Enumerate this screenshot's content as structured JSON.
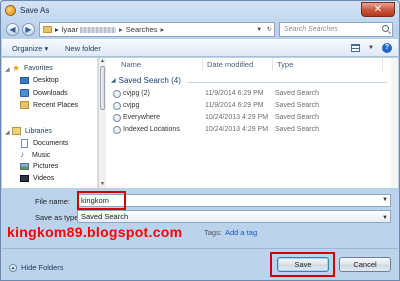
{
  "window": {
    "title": "Save As",
    "close_glyph": "✕"
  },
  "address": {
    "crumbs": [
      "lyaar",
      "Searches"
    ],
    "back_glyph": "◀",
    "forward_glyph": "▶"
  },
  "search": {
    "placeholder": "Search Searches"
  },
  "toolbar": {
    "organize_label": "Organize ▾",
    "new_folder_label": "New folder",
    "help_glyph": "?"
  },
  "sidebar": {
    "favorites_label": "Favorites",
    "favorites": [
      "Desktop",
      "Downloads",
      "Recent Places"
    ],
    "libraries_label": "Libraries",
    "libraries": [
      "Documents",
      "Music",
      "Pictures",
      "Videos"
    ]
  },
  "columns": {
    "name": "Name",
    "date": "Date modified",
    "type": "Type"
  },
  "group": {
    "label": "Saved Search (4)"
  },
  "files": [
    {
      "name": "cvjpg (2)",
      "date": "11/9/2014 6:29 PM",
      "type": "Saved Search"
    },
    {
      "name": "cvjpg",
      "date": "11/9/2014 6:29 PM",
      "type": "Saved Search"
    },
    {
      "name": "Everywhere",
      "date": "10/24/2013 4:29 PM",
      "type": "Saved Search"
    },
    {
      "name": "Indexed Locations",
      "date": "10/24/2013 4:29 PM",
      "type": "Saved Search"
    }
  ],
  "form": {
    "filename_label": "File name:",
    "filename_value": "kingkom",
    "saveas_label": "Save as type:",
    "saveas_value": "Saved Search",
    "tags_label": "Tags:",
    "tags_link": "Add a tag"
  },
  "watermark": "kingkom89.blogspot.com",
  "footer": {
    "hide_folders_label": "Hide Folders",
    "save_label": "Save",
    "cancel_label": "Cancel"
  },
  "colors": {
    "highlight": "#d40000",
    "watermark": "#ff0000"
  }
}
